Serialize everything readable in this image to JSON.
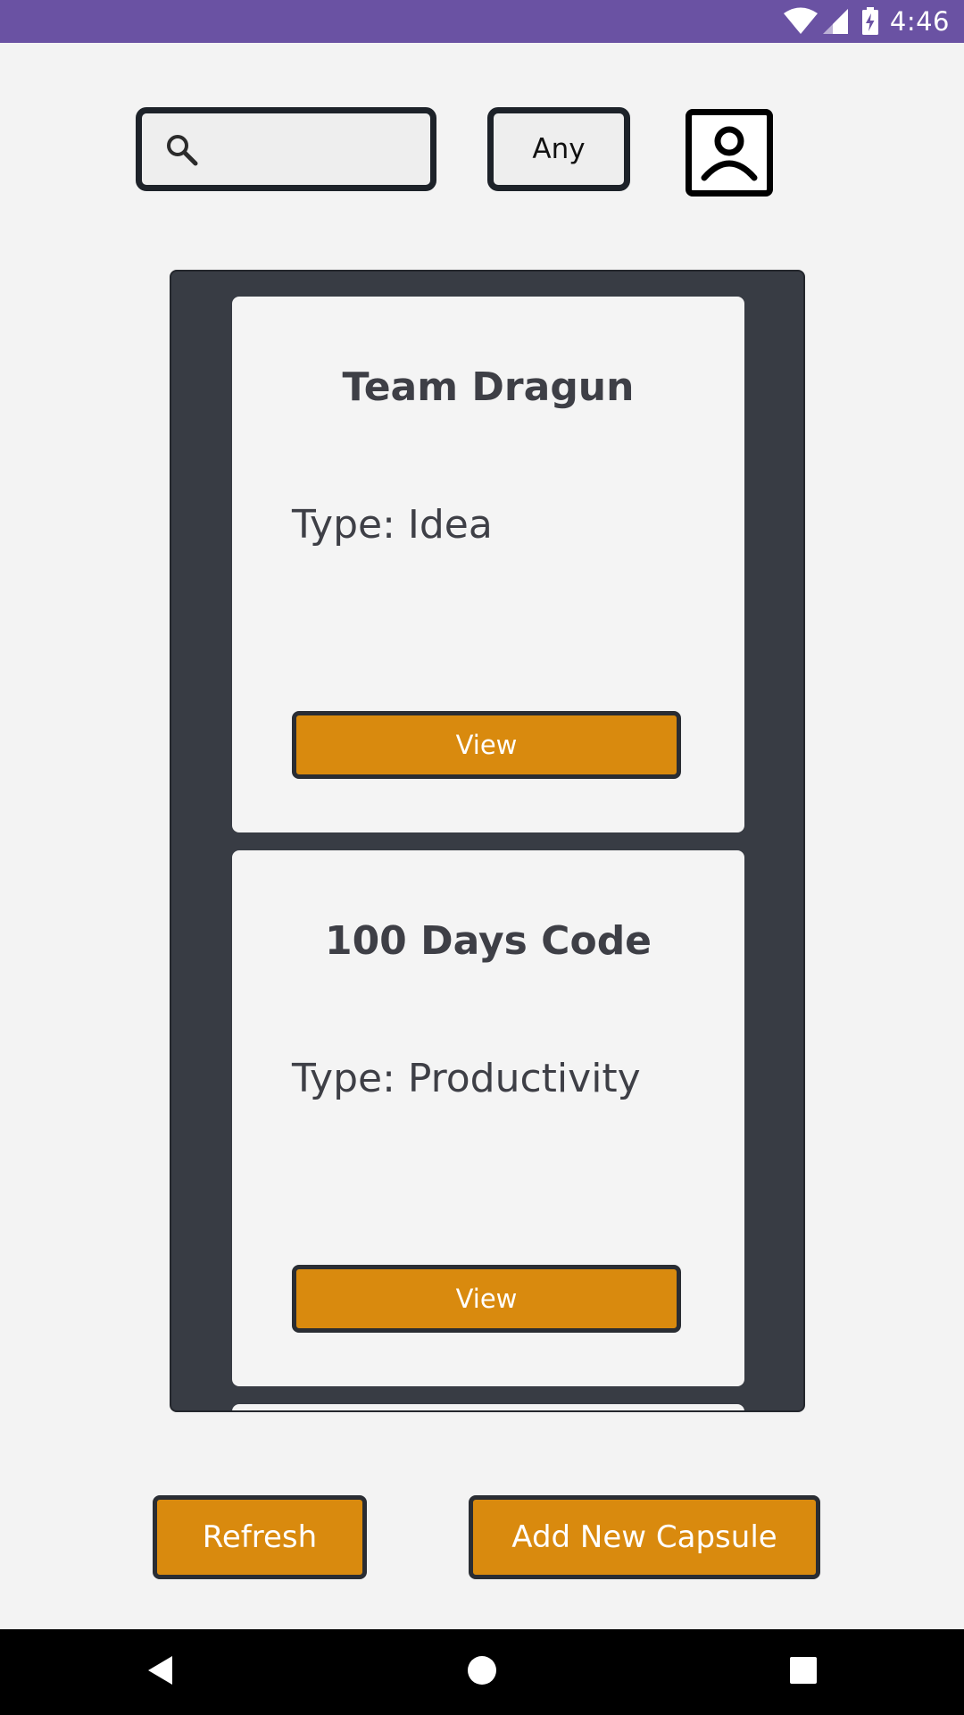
{
  "status_bar": {
    "time": "4:46",
    "icons": [
      "wifi-icon",
      "cell-signal-icon",
      "battery-charging-icon"
    ],
    "background_color": "#6a52a3"
  },
  "toolbar": {
    "search": {
      "icon": "search-icon",
      "value": "",
      "placeholder": ""
    },
    "filter": {
      "selected": "Any"
    },
    "profile_icon": "profile-icon"
  },
  "capsules": [
    {
      "title": "Team Dragun",
      "type_label": "Type: Idea",
      "view_label": "View"
    },
    {
      "title": "100 Days Code",
      "type_label": "Type: Productivity",
      "view_label": "View"
    }
  ],
  "actions": {
    "refresh_label": "Refresh",
    "add_label": "Add New Capsule"
  },
  "colors": {
    "accent": "#d98a0e",
    "panel": "#383c44",
    "card": "#f4f4f4",
    "text": "#3e3f46",
    "background": "#f3f3f3"
  },
  "nav_bar": {
    "icons": [
      "back-icon",
      "home-icon",
      "recents-icon"
    ]
  }
}
